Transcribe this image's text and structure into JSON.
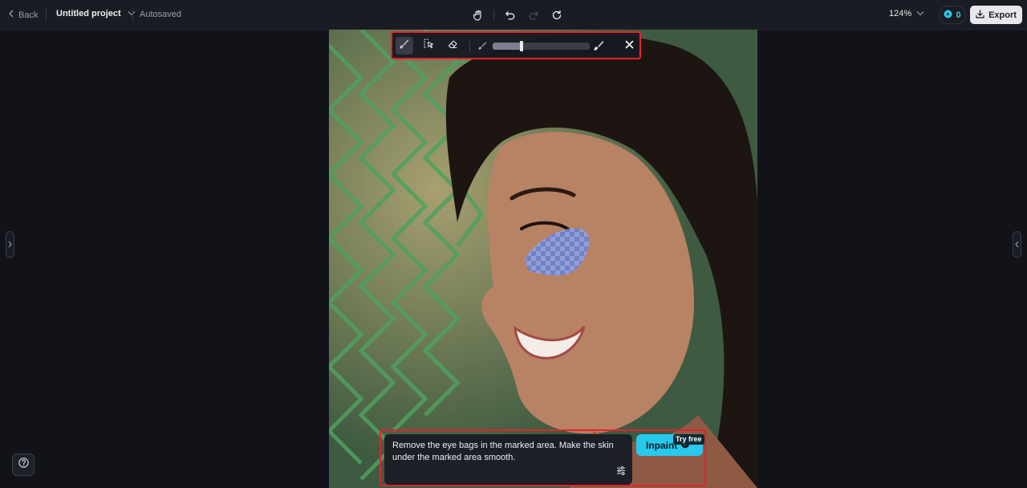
{
  "topbar": {
    "back_label": "Back",
    "project_name": "Untitled project",
    "save_status": "Autosaved",
    "zoom_level": "124%",
    "credits_count": "0",
    "export_label": "Export"
  },
  "prompt": {
    "text": "Remove the eye bags in the marked area. Make the skin under the marked area smooth.",
    "action_label": "Inpaint",
    "action_badge": "Try free"
  },
  "brush_toolbar": {
    "brush_size_fraction": 0.3
  },
  "colors": {
    "accent": "#28c9ec",
    "highlight_border": "#e0242a",
    "mask_fill": "#7b8fd6",
    "background": "#121319"
  }
}
